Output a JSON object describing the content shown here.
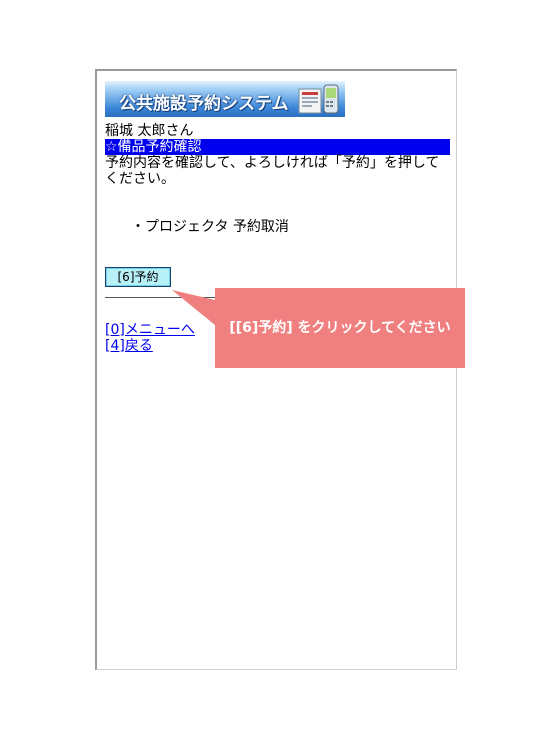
{
  "header": {
    "logo_text": "公共施設予約システム"
  },
  "user": {
    "name": "稲城 太郎さん"
  },
  "section": {
    "title": "☆備品予約確認"
  },
  "instruction": "予約内容を確認して、よろしければ「予約」を押してください。",
  "items": [
    {
      "text": "・プロジェクタ 予約取消"
    }
  ],
  "actions": {
    "reserve_label": "[6]予約"
  },
  "links": {
    "menu": "[0]メニューへ",
    "back": "[4]戻る"
  },
  "callout": {
    "text": "[[6]予約] をクリックしてください",
    "color": "#f08080"
  },
  "colors": {
    "section_bar": "#0000ee",
    "link": "#0000ee",
    "button_bg": "#b8f0f8"
  }
}
